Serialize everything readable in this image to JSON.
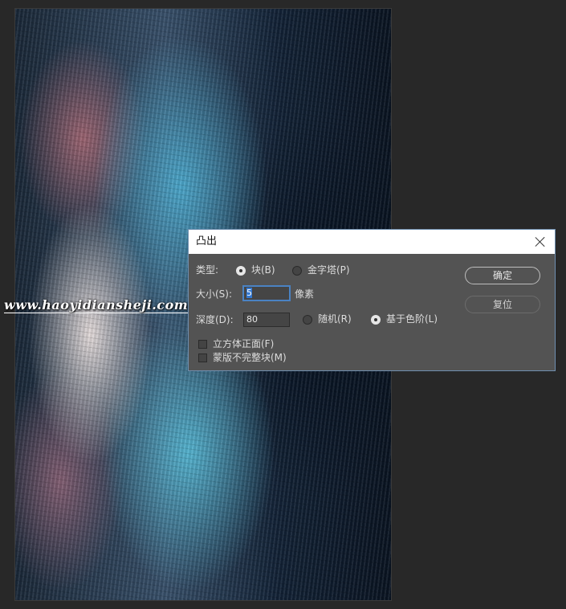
{
  "watermark": "www.haoyidiansheji.com",
  "dialog": {
    "title": "凸出",
    "type_label": "类型:",
    "type_options": [
      {
        "label": "块(B)",
        "checked": true
      },
      {
        "label": "金字塔(P)",
        "checked": false
      }
    ],
    "size_label": "大小(S):",
    "size_value": "5",
    "size_unit": "像素",
    "depth_label": "深度(D):",
    "depth_value": "80",
    "depth_options": [
      {
        "label": "随机(R)",
        "checked": false
      },
      {
        "label": "基于色阶(L)",
        "checked": true
      }
    ],
    "checkboxes": [
      {
        "label": "立方体正面(F)",
        "checked": false
      },
      {
        "label": "蒙版不完整块(M)",
        "checked": false
      }
    ],
    "ok_label": "确定",
    "reset_label": "复位"
  }
}
